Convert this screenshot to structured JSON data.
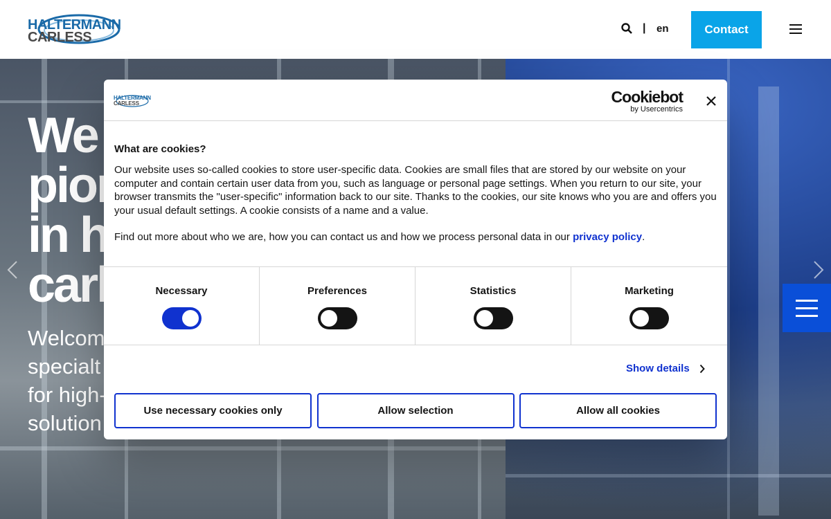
{
  "header": {
    "logo_line1": "HALTERMANN",
    "logo_line2": "CARLESS",
    "search_icon": "search-icon",
    "separator": "|",
    "language": "en",
    "contact_label": "Contact",
    "menu_icon": "hamburger-icon",
    "accent_color": "#0aa4e8"
  },
  "hero": {
    "title_lines": [
      "We",
      "pion",
      "in h",
      "carl"
    ],
    "subtitle_lines": [
      "Welcom",
      "specialt",
      "for high-",
      "solution"
    ],
    "prev_icon": "chevron-left-icon",
    "next_icon": "chevron-right-icon",
    "side_menu_icon": "hamburger-icon",
    "side_menu_color": "#0a4fd8"
  },
  "cookie_dialog": {
    "logo_line1": "HALTERMANN",
    "logo_line2": "CARLESS",
    "brand_name": "Cookiebot",
    "brand_by": "by Usercentrics",
    "close_icon": "close-icon",
    "heading": "What are cookies?",
    "paragraph1": "Our website uses so-called cookies to store user-specific data. Cookies are small files that are stored by our website on your computer and contain certain user data from you, such as language or personal page settings. When you return to our site, your browser transmits the \"user-specific\" information back to our site. Thanks to the cookies, our site knows who you are and offers you your usual default settings. A cookie consists of a name and a value.",
    "paragraph2_text": "Find out more about who we are, how you can contact us and how we process personal data in our ",
    "privacy_link": "privacy policy",
    "paragraph2_end": ".",
    "categories": [
      {
        "label": "Necessary",
        "enabled": true
      },
      {
        "label": "Preferences",
        "enabled": false
      },
      {
        "label": "Statistics",
        "enabled": false
      },
      {
        "label": "Marketing",
        "enabled": false
      }
    ],
    "show_details": "Show details",
    "buttons": {
      "necessary_only": "Use necessary cookies only",
      "allow_selection": "Allow selection",
      "allow_all": "Allow all cookies"
    },
    "accent_color": "#1032cf"
  }
}
